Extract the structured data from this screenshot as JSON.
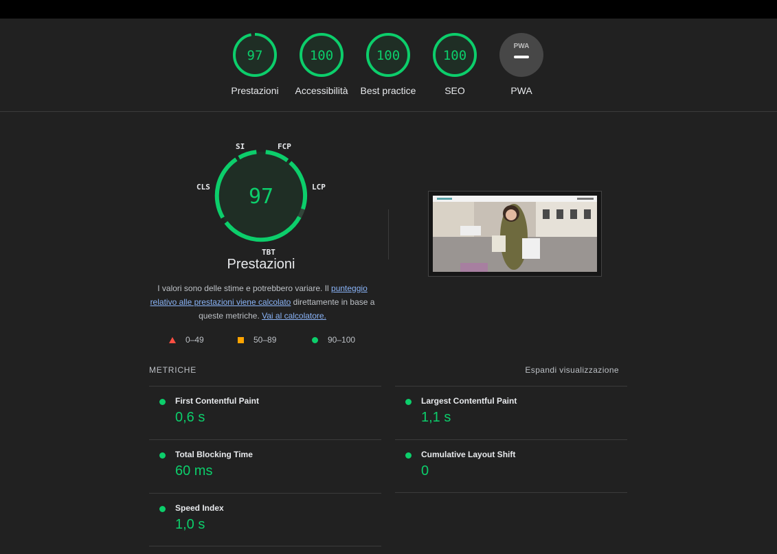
{
  "categories": [
    {
      "label": "Prestazioni",
      "score": "97",
      "value": 97
    },
    {
      "label": "Accessibilità",
      "score": "100",
      "value": 100
    },
    {
      "label": "Best practice",
      "score": "100",
      "value": 100
    },
    {
      "label": "SEO",
      "score": "100",
      "value": 100
    },
    {
      "label": "PWA",
      "badge": "PWA"
    }
  ],
  "performance": {
    "score": "97",
    "title": "Prestazioni",
    "tags": {
      "si": "SI",
      "fcp": "FCP",
      "lcp": "LCP",
      "tbt": "TBT",
      "cls": "CLS"
    },
    "desc_1": "I valori sono delle stime e potrebbero variare. Il ",
    "desc_link": "punteggio relativo alle prestazioni viene calcolato",
    "desc_2": " direttamente in base a queste metriche. ",
    "desc_link2": "Vai al calcolatore."
  },
  "legend": {
    "fail": "0–49",
    "average": "50–89",
    "pass": "90–100"
  },
  "metrics_section": {
    "title": "METRICHE",
    "expand": "Espandi visualizzazione"
  },
  "metrics": [
    {
      "name": "First Contentful Paint",
      "value": "0,6 s"
    },
    {
      "name": "Largest Contentful Paint",
      "value": "1,1 s"
    },
    {
      "name": "Total Blocking Time",
      "value": "60 ms"
    },
    {
      "name": "Cumulative Layout Shift",
      "value": "0"
    },
    {
      "name": "Speed Index",
      "value": "1,0 s"
    }
  ],
  "colors": {
    "pass": "#0cce6b",
    "average": "#ffa400",
    "fail": "#ff4e42",
    "bg": "#212121"
  }
}
